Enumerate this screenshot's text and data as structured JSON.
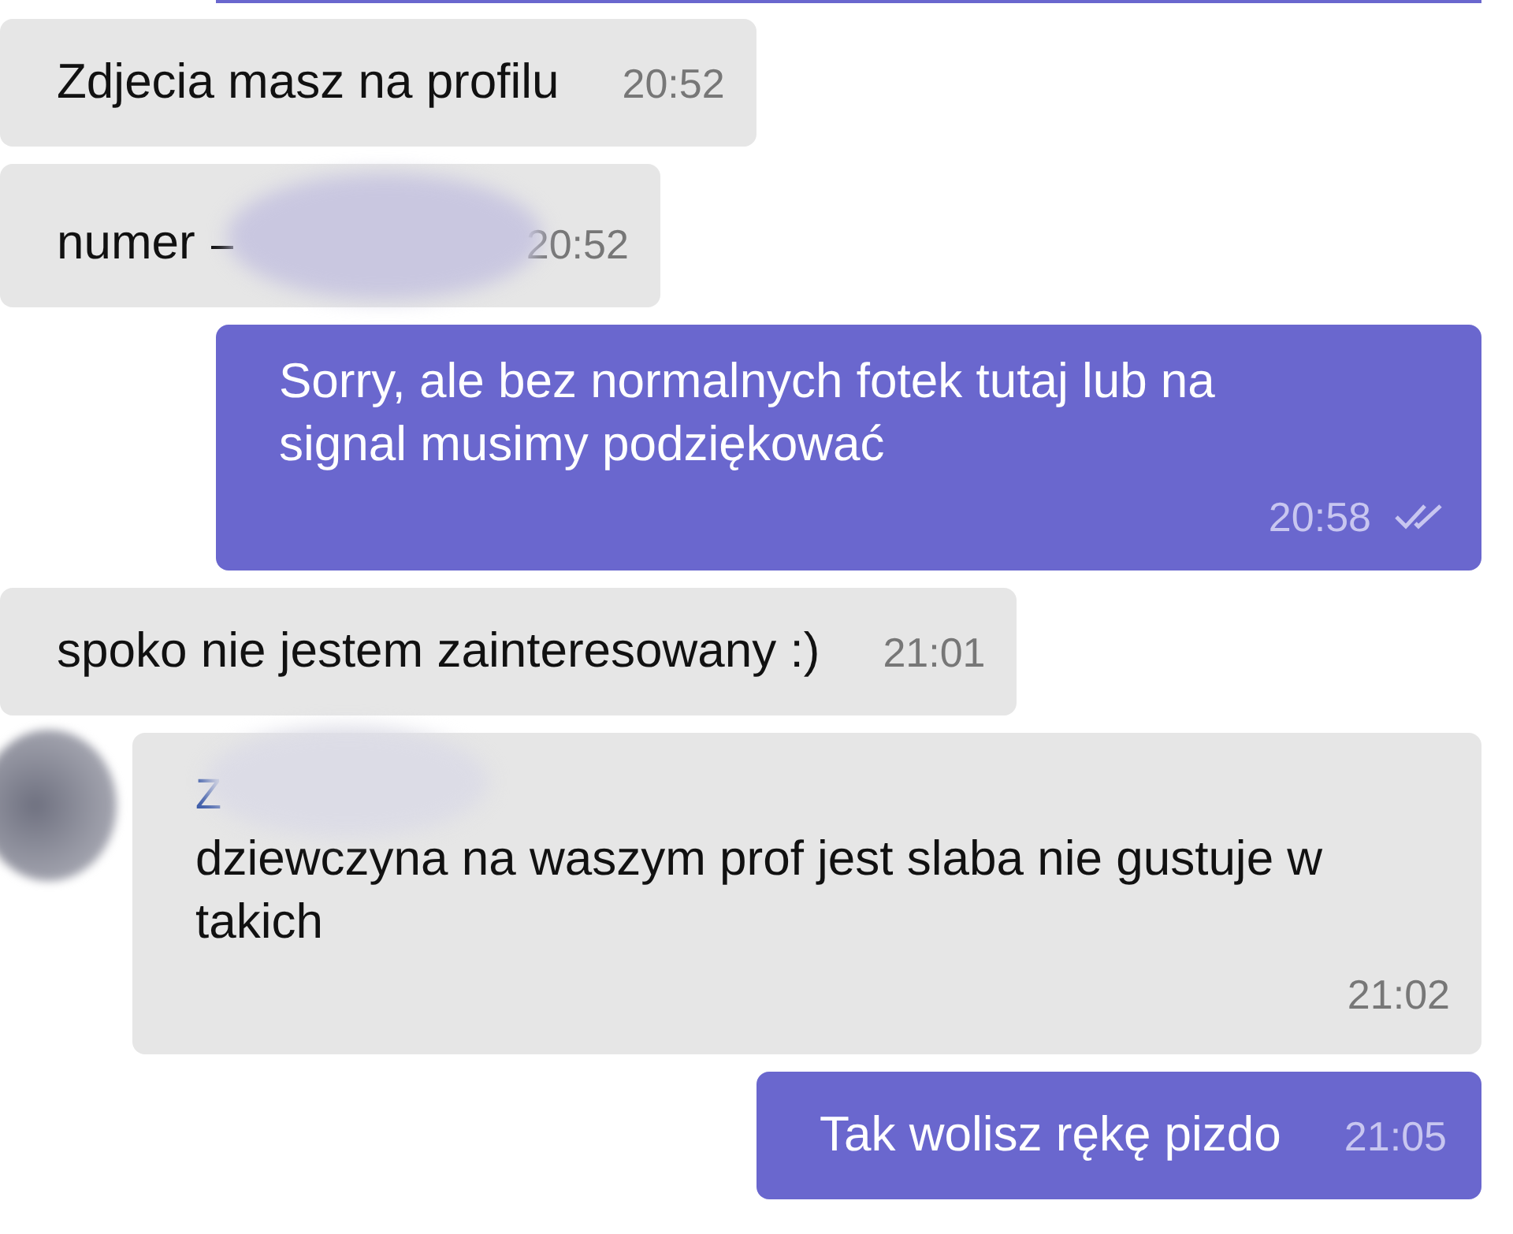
{
  "messages": [
    {
      "kind": "edge"
    },
    {
      "kind": "incoming",
      "text": "Zdjecia masz na profilu",
      "time": "20:52"
    },
    {
      "kind": "incoming",
      "text": "numer",
      "redacted": true,
      "time": "20:52"
    },
    {
      "kind": "outgoing",
      "text": "Sorry, ale bez normalnych fotek tutaj lub na signal musimy podziękować",
      "time": "20:58",
      "read": true,
      "short": false
    },
    {
      "kind": "incoming",
      "text": "spoko nie jestem zainteresowany :)",
      "time": "21:01"
    },
    {
      "kind": "group",
      "sender": "Z",
      "sender_redacted": true,
      "avatar": true,
      "text": "dziewczyna na waszym prof jest slaba nie gustuje w takich",
      "time": "21:02"
    },
    {
      "kind": "outgoing",
      "text": "Tak wolisz rękę pizdo",
      "time": "21:05",
      "short": true
    }
  ]
}
